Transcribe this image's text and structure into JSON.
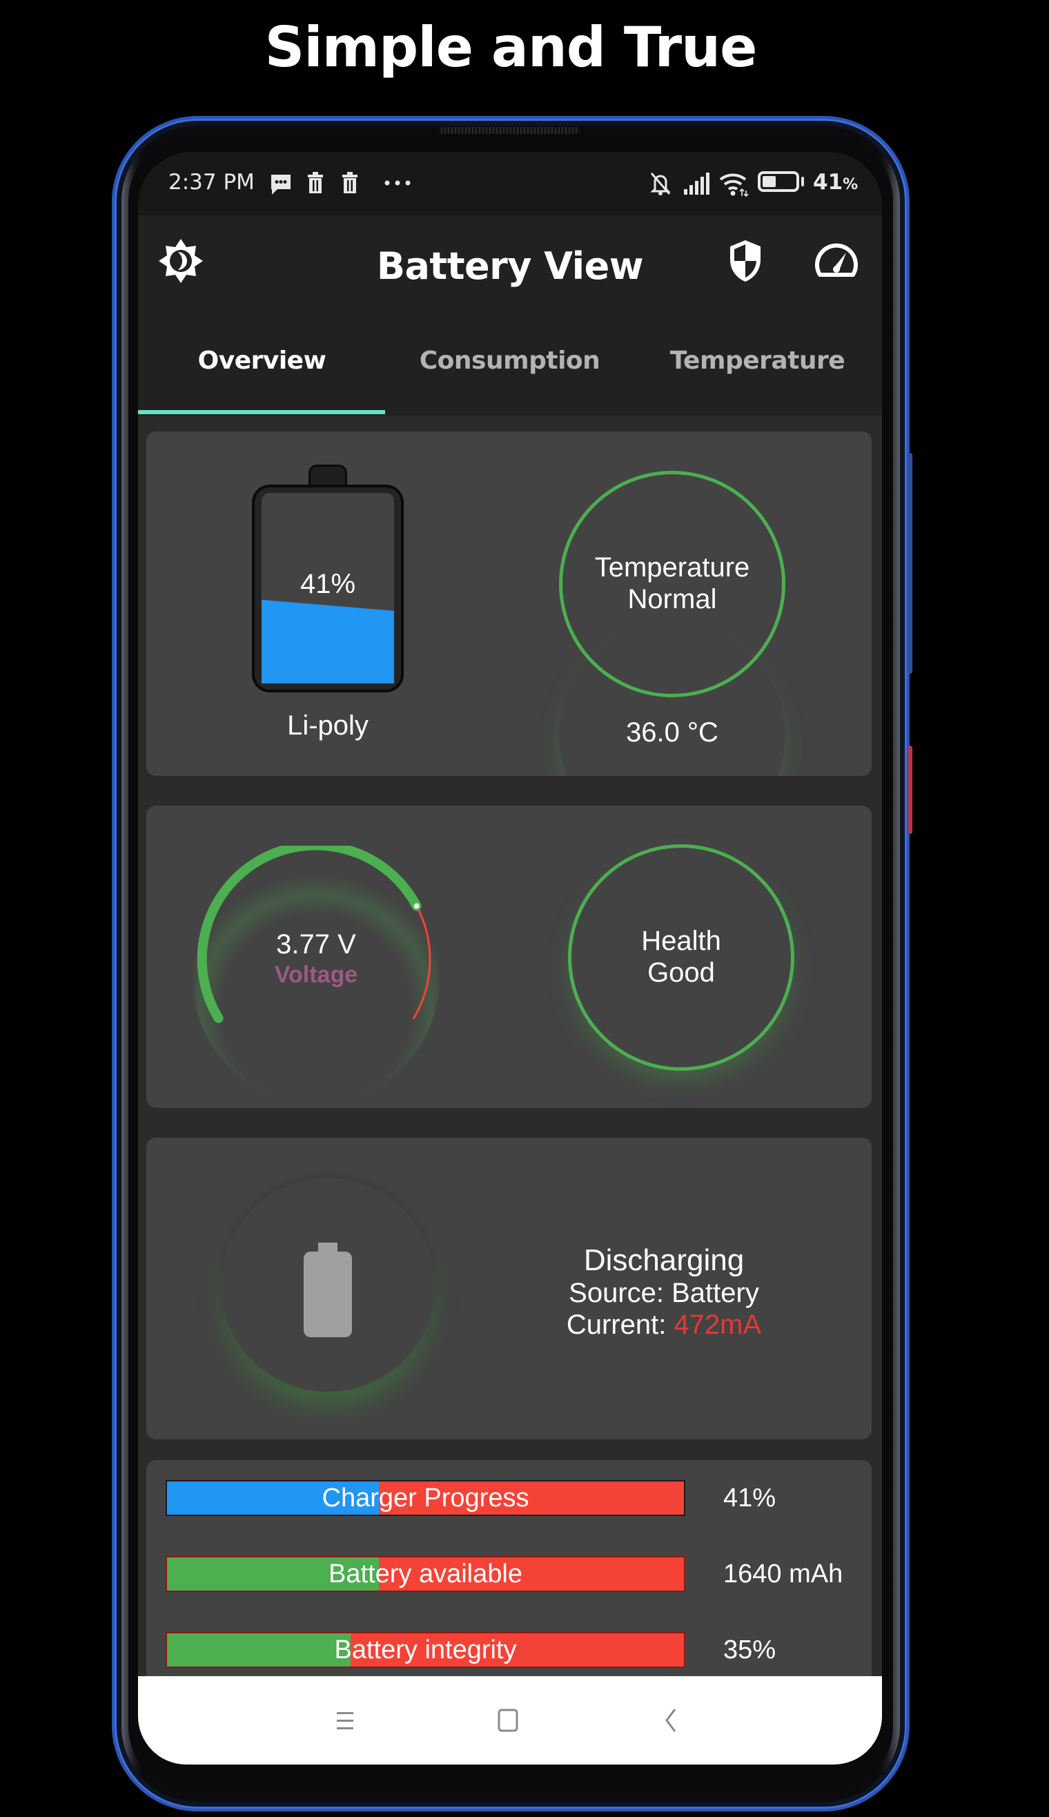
{
  "promo": {
    "title": "Simple and True"
  },
  "status_bar": {
    "time": "2:37 PM",
    "left_icons": [
      "message-icon",
      "trash-icon",
      "trash-icon",
      "more-dots-icon"
    ],
    "right_icons": [
      "bell-off-icon",
      "signal-icon",
      "wifi-icon",
      "battery-icon"
    ],
    "battery_percent": "41",
    "battery_percent_suffix": "%",
    "battery_level": 0.41
  },
  "app_bar": {
    "title": "Battery View",
    "left_icon": "theme-brightness-icon",
    "right_icons": [
      "shield-icon",
      "speedometer-icon"
    ]
  },
  "tabs": [
    {
      "label": "Overview",
      "active": true
    },
    {
      "label": "Consumption",
      "active": false
    },
    {
      "label": "Temperature",
      "active": false
    }
  ],
  "overview": {
    "battery_level_percent": 41,
    "battery_level_label": "41%",
    "battery_type": "Li-poly",
    "temperature_status_line1": "Temperature",
    "temperature_status_line2": "Normal",
    "temperature_value": "36.0 °C"
  },
  "gauges": {
    "voltage_value": "3.77 V",
    "voltage_label": "Voltage",
    "voltage_gauge_fraction": 0.756,
    "health_line1": "Health",
    "health_line2": "Good"
  },
  "charging": {
    "state": "Discharging",
    "source_label": "Source: Battery",
    "current_prefix": "Current: ",
    "current_value": "472mA"
  },
  "bars": [
    {
      "label": "Charger Progress",
      "value": "41%",
      "fraction": 0.41,
      "fill_color": "#2196f3"
    },
    {
      "label": "Battery available",
      "value": "1640 mAh",
      "fraction": 0.41,
      "fill_color": "#4caf50"
    },
    {
      "label": "Battery integrity",
      "value": "35%",
      "fraction": 0.355,
      "fill_color": "#4caf50"
    }
  ],
  "nav_bar": {
    "buttons": [
      "recents-icon",
      "home-icon",
      "back-icon"
    ]
  },
  "colors": {
    "accent_tab": "#64e4c4",
    "good_green": "#4caf50",
    "battery_blue": "#2196f3",
    "bar_red": "#f44336",
    "voltage_label": "#9c5a86",
    "current_red": "#e53935"
  }
}
